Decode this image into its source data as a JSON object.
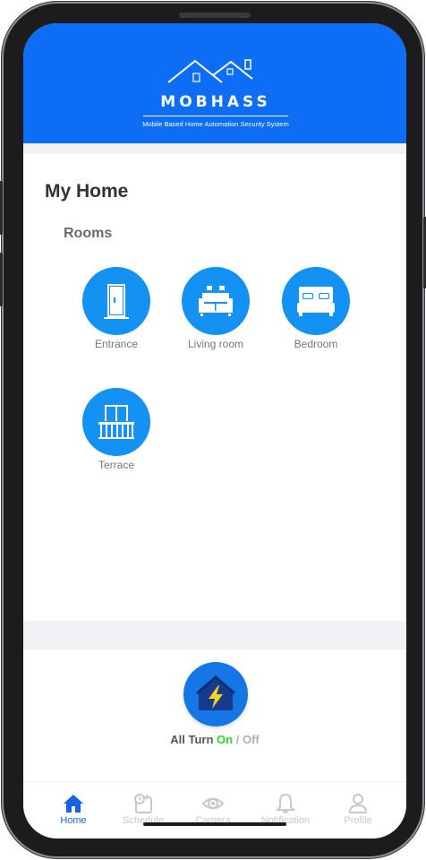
{
  "header": {
    "app_name": "MOBHASS",
    "tagline": "Mobile Based Home Automation Security System"
  },
  "page": {
    "title": "My Home",
    "rooms_heading": "Rooms"
  },
  "rooms": [
    {
      "label": "Entrance",
      "icon": "door-icon"
    },
    {
      "label": "Living room",
      "icon": "sofa-icon"
    },
    {
      "label": "Bedroom",
      "icon": "bed-icon"
    },
    {
      "label": "Terrace",
      "icon": "balcony-icon"
    }
  ],
  "power": {
    "prefix": "All Turn",
    "on_label": "On",
    "separator": "/",
    "off_label": "Off",
    "icon": "home-power-icon"
  },
  "nav": {
    "items": [
      {
        "label": "Home",
        "icon": "home-icon",
        "active": true
      },
      {
        "label": "Schedule",
        "icon": "schedule-icon",
        "active": false
      },
      {
        "label": "Camera",
        "icon": "eye-icon",
        "active": false
      },
      {
        "label": "Notification",
        "icon": "bell-icon",
        "active": false
      },
      {
        "label": "Profile",
        "icon": "person-icon",
        "active": false
      }
    ]
  },
  "colors": {
    "header": "#0d6ef5",
    "room_circle": "#1492f4",
    "on": "#2bd62b",
    "nav_active": "#1565e0"
  }
}
